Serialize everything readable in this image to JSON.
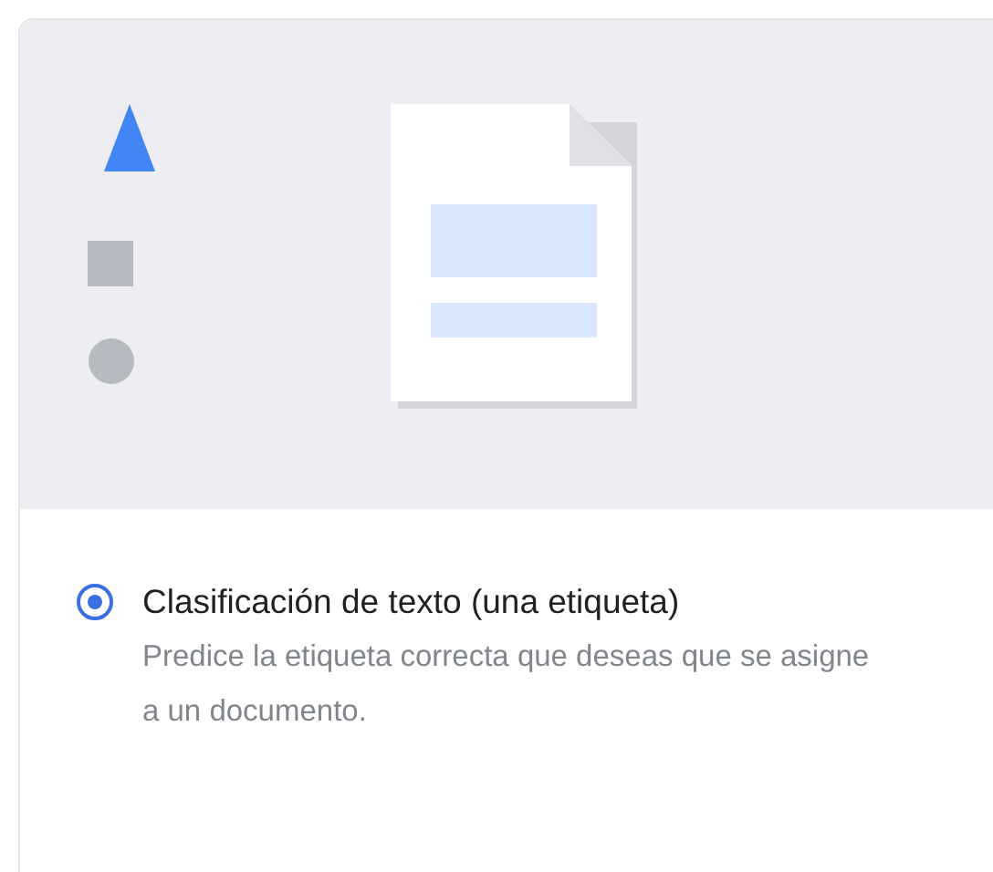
{
  "option": {
    "title": "Clasificación de texto (una etiqueta)",
    "description": "Predice la etiqueta correcta que deseas que se asigne a un documento.",
    "selected": true
  }
}
